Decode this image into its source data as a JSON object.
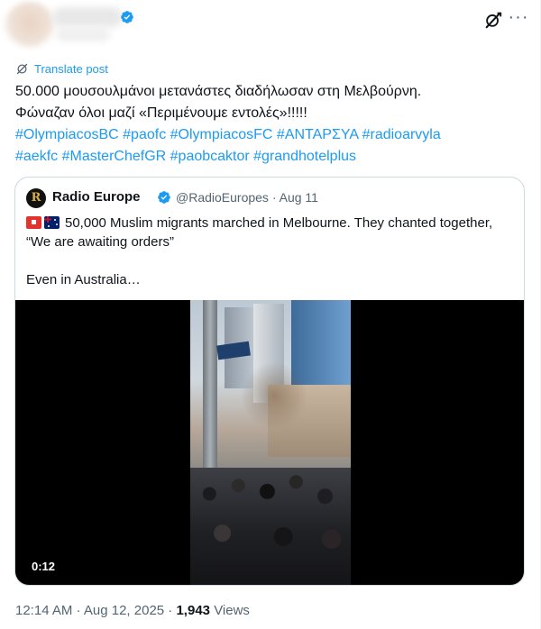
{
  "post": {
    "translate_label": "Translate post",
    "text_lines": [
      "50.000 μουσουλμάνοι μετανάστες διαδήλωσαν στη Μελβούρνη.",
      "Φώναζαν όλοι μαζί «Περιμένουμε εντολές»!!!!!"
    ],
    "hashtags": [
      "#OlympiacosBC",
      "#paofc",
      "#OlympiacosFC",
      "#ΑΝΤΑΡΣΥΑ",
      "#radioarvyla",
      "#aekfc",
      "#MasterChefGR",
      "#paobcaktor",
      "#grandhotelplus"
    ],
    "timestamp": "12:14 AM · Aug 12, 2025",
    "separator": " · ",
    "views_count": "1,943",
    "views_label": "Views",
    "more_glyph": "···"
  },
  "quote": {
    "avatar_letter": "R",
    "name": "Radio Europe",
    "handle_date": "@RadioEuropes · Aug 11",
    "text_line1": "50,000 Muslim migrants marched in Melbourne. They chanted together,",
    "text_line2": "“We are awaiting orders”",
    "text_line3": "Even in Australia…",
    "video_time": "0:12"
  },
  "icons": [
    "verified-badge-icon",
    "grok-icon",
    "more-icon",
    "translate-icon",
    "siren-flag-icon",
    "australia-flag-icon"
  ],
  "colors": {
    "accent": "#1d9bf0",
    "text": "#0f1419",
    "muted": "#536471",
    "border": "#cfd9de"
  }
}
